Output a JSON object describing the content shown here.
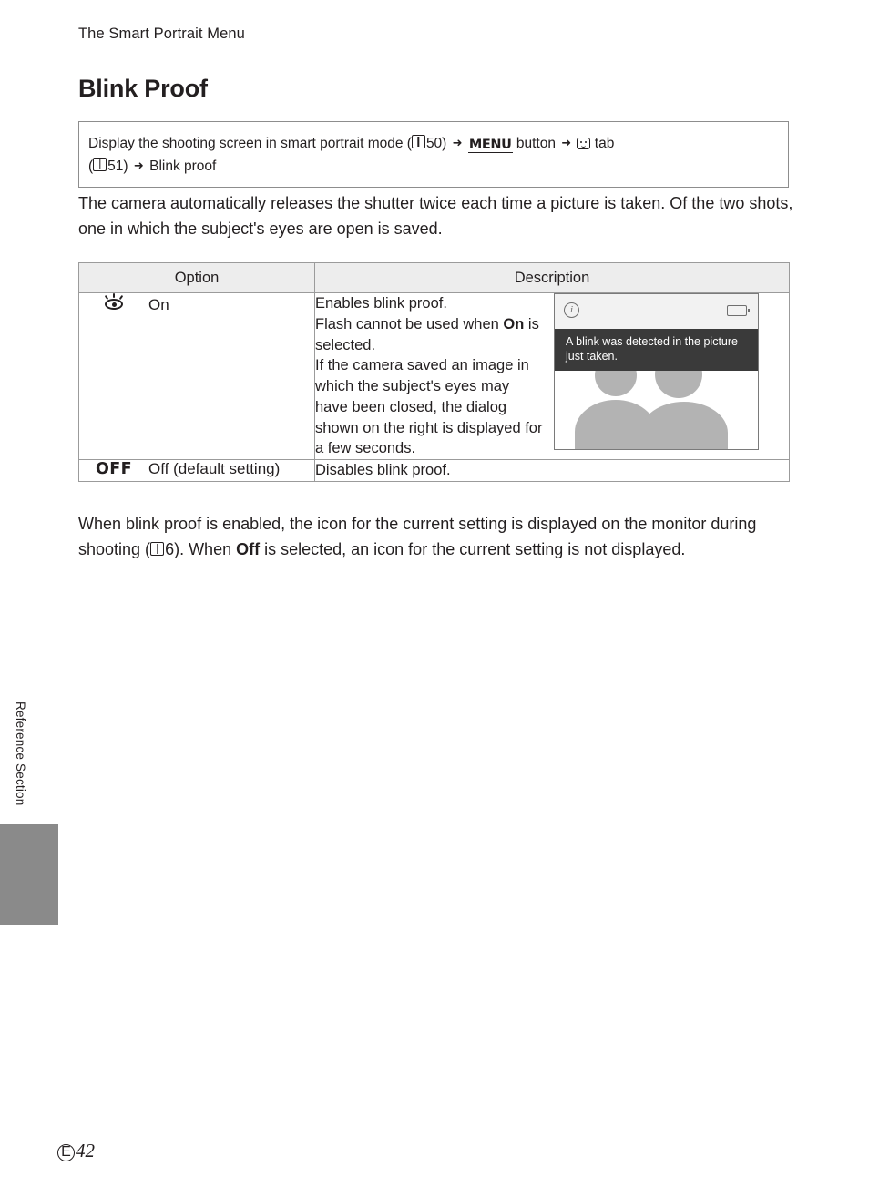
{
  "header": {
    "running_head": "The Smart Portrait Menu",
    "title": "Blink Proof"
  },
  "navbox": {
    "line1_a": "Display the shooting screen in smart portrait mode (",
    "line1_ref": "50)",
    "line1_b": "button",
    "line1_c": "tab",
    "line2_a": "(",
    "line2_ref": "51)",
    "line2_b": "Blink proof",
    "menu_label": "MENU",
    "arrow": "➜"
  },
  "paragraphs": {
    "intro": "The camera automatically releases the shutter twice each time a picture is taken. Of the two shots, one in which the subject's eyes are open is saved.",
    "outro_1": "When blink proof is enabled, the icon for the current setting is displayed on the monitor during shooting (",
    "outro_ref": "6). When ",
    "outro_bold": "Off",
    "outro_2": " is selected, an icon for the current setting is not displayed."
  },
  "table": {
    "headers": {
      "option": "Option",
      "description": "Description"
    },
    "rows": [
      {
        "icon": "blink-proof-icon",
        "label": "On",
        "desc_line1": "Enables blink proof.",
        "desc_line2_a": "Flash cannot be used when ",
        "desc_line2_bold": "On",
        "desc_line2_b": " is selected.",
        "desc_line3": "If the camera saved an image in which the subject's eyes may have been closed, the dialog shown on the right is displayed for a few seconds."
      },
      {
        "icon": "OFF",
        "label": "Off (default setting)",
        "desc_line1": "Disables blink proof."
      }
    ]
  },
  "camera_screen": {
    "info_glyph": "i",
    "message": "A blink was detected in the picture just taken."
  },
  "side": {
    "vertical_label": "Reference Section"
  },
  "footer": {
    "mark": "E",
    "page": "42"
  }
}
